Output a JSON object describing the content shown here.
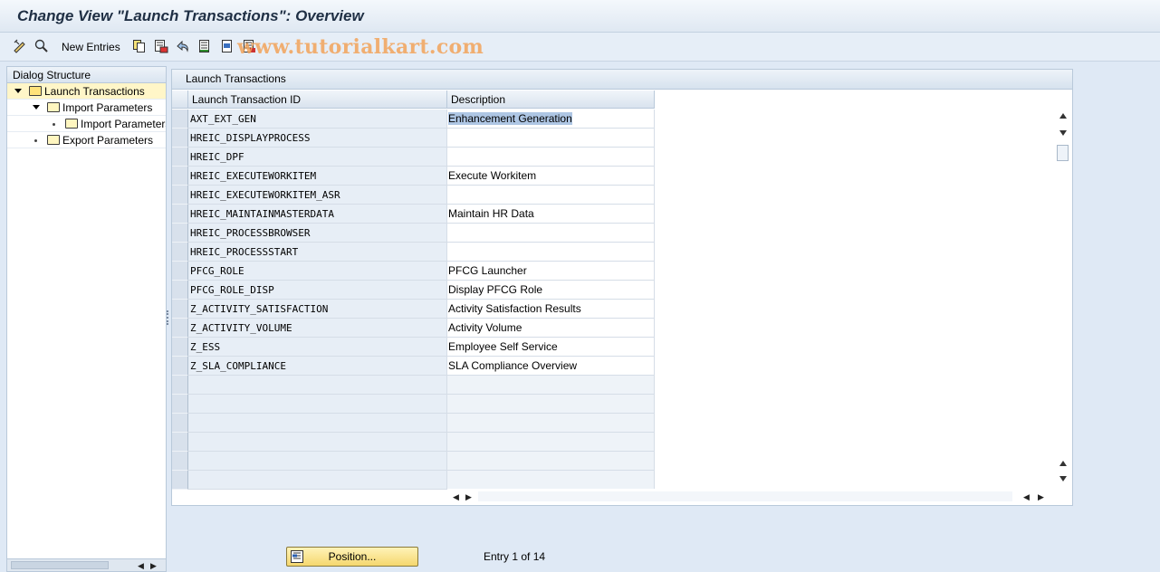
{
  "window": {
    "title": "Change View \"Launch Transactions\": Overview"
  },
  "toolbar": {
    "new_entries_label": "New Entries",
    "watermark": "www.tutorialkart.com",
    "icons": [
      "edit-icon",
      "find-icon",
      "copy-icon",
      "delete-icon",
      "undo-icon",
      "select-all-icon",
      "select-block-icon",
      "deselect-all-icon"
    ]
  },
  "dialog_structure": {
    "header": "Dialog Structure",
    "items": [
      {
        "label": "Launch Transactions",
        "level": 0,
        "expanded": true,
        "selected": true
      },
      {
        "label": "Import Parameters",
        "level": 1,
        "expanded": true,
        "selected": false
      },
      {
        "label": "Import Parameters",
        "level": 2,
        "expanded": false,
        "selected": false
      },
      {
        "label": "Export Parameters",
        "level": 1,
        "expanded": false,
        "selected": false
      }
    ]
  },
  "table": {
    "title": "Launch Transactions",
    "columns": [
      "Launch Transaction ID",
      "Description"
    ],
    "rows": [
      {
        "id": "AXT_EXT_GEN",
        "desc": "Enhancement Generation"
      },
      {
        "id": "HREIC_DISPLAYPROCESS",
        "desc": ""
      },
      {
        "id": "HREIC_DPF",
        "desc": ""
      },
      {
        "id": "HREIC_EXECUTEWORKITEM",
        "desc": "Execute Workitem"
      },
      {
        "id": "HREIC_EXECUTEWORKITEM_ASR",
        "desc": ""
      },
      {
        "id": "HREIC_MAINTAINMASTERDATA",
        "desc": "Maintain HR Data"
      },
      {
        "id": "HREIC_PROCESSBROWSER",
        "desc": ""
      },
      {
        "id": "HREIC_PROCESSSTART",
        "desc": ""
      },
      {
        "id": "PFCG_ROLE",
        "desc": "PFCG Launcher"
      },
      {
        "id": "PFCG_ROLE_DISP",
        "desc": "Display PFCG Role"
      },
      {
        "id": "Z_ACTIVITY_SATISFACTION",
        "desc": "Activity Satisfaction Results"
      },
      {
        "id": "Z_ACTIVITY_VOLUME",
        "desc": "Activity Volume"
      },
      {
        "id": "Z_ESS",
        "desc": "Employee Self Service"
      },
      {
        "id": "Z_SLA_COMPLIANCE",
        "desc": "SLA Compliance Overview"
      }
    ],
    "empty_rows": 6
  },
  "footer": {
    "position_button": "Position...",
    "entry_info": "Entry 1 of 14"
  }
}
